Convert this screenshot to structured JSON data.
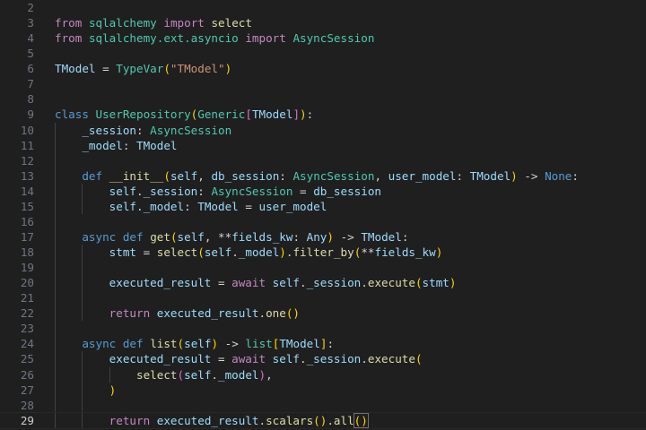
{
  "editor": {
    "current_line": 29,
    "lines": [
      {
        "n": "2",
        "indent": 0,
        "tokens": []
      },
      {
        "n": "3",
        "indent": 0,
        "tokens": [
          [
            "from",
            "kw"
          ],
          [
            " ",
            "op"
          ],
          [
            "sqlalchemy",
            "ty"
          ],
          [
            " ",
            "op"
          ],
          [
            "import",
            "kw"
          ],
          [
            " ",
            "op"
          ],
          [
            "select",
            "fn"
          ]
        ]
      },
      {
        "n": "4",
        "indent": 0,
        "tokens": [
          [
            "from",
            "kw"
          ],
          [
            " ",
            "op"
          ],
          [
            "sqlalchemy.ext.asyncio",
            "ty"
          ],
          [
            " ",
            "op"
          ],
          [
            "import",
            "kw"
          ],
          [
            " ",
            "op"
          ],
          [
            "AsyncSession",
            "ty"
          ]
        ]
      },
      {
        "n": "5",
        "indent": 0,
        "tokens": []
      },
      {
        "n": "6",
        "indent": 0,
        "tokens": [
          [
            "TModel",
            "va"
          ],
          [
            " = ",
            "op"
          ],
          [
            "TypeVar",
            "ty"
          ],
          [
            "(",
            "b1"
          ],
          [
            "\"TModel\"",
            "str"
          ],
          [
            ")",
            "b1"
          ]
        ]
      },
      {
        "n": "7",
        "indent": 0,
        "tokens": []
      },
      {
        "n": "8",
        "indent": 0,
        "tokens": []
      },
      {
        "n": "9",
        "indent": 0,
        "tokens": [
          [
            "class",
            "st"
          ],
          [
            " ",
            "op"
          ],
          [
            "UserRepository",
            "ty"
          ],
          [
            "(",
            "b1"
          ],
          [
            "Generic",
            "ty"
          ],
          [
            "[",
            "b2"
          ],
          [
            "TModel",
            "va"
          ],
          [
            "]",
            "b2"
          ],
          [
            ")",
            "b1"
          ],
          [
            ":",
            "op"
          ]
        ]
      },
      {
        "n": "10",
        "indent": 1,
        "tokens": [
          [
            "_session",
            "va"
          ],
          [
            ": ",
            "op"
          ],
          [
            "AsyncSession",
            "ty"
          ]
        ]
      },
      {
        "n": "11",
        "indent": 1,
        "tokens": [
          [
            "_model",
            "va"
          ],
          [
            ": ",
            "op"
          ],
          [
            "TModel",
            "va"
          ]
        ]
      },
      {
        "n": "12",
        "indent": 1,
        "tokens": []
      },
      {
        "n": "13",
        "indent": 1,
        "tokens": [
          [
            "def",
            "st"
          ],
          [
            " ",
            "op"
          ],
          [
            "__init__",
            "fn"
          ],
          [
            "(",
            "b1"
          ],
          [
            "self",
            "va"
          ],
          [
            ", ",
            "op"
          ],
          [
            "db_session",
            "va"
          ],
          [
            ": ",
            "op"
          ],
          [
            "AsyncSession",
            "ty"
          ],
          [
            ", ",
            "op"
          ],
          [
            "user_model",
            "va"
          ],
          [
            ": ",
            "op"
          ],
          [
            "TModel",
            "va"
          ],
          [
            ")",
            "b1"
          ],
          [
            " -> ",
            "op"
          ],
          [
            "None",
            "st"
          ],
          [
            ":",
            "op"
          ]
        ]
      },
      {
        "n": "14",
        "indent": 2,
        "tokens": [
          [
            "self",
            "va"
          ],
          [
            ".",
            "op"
          ],
          [
            "_session",
            "va"
          ],
          [
            ": ",
            "op"
          ],
          [
            "AsyncSession",
            "ty"
          ],
          [
            " = ",
            "op"
          ],
          [
            "db_session",
            "va"
          ]
        ]
      },
      {
        "n": "15",
        "indent": 2,
        "tokens": [
          [
            "self",
            "va"
          ],
          [
            ".",
            "op"
          ],
          [
            "_model",
            "va"
          ],
          [
            ": ",
            "op"
          ],
          [
            "TModel",
            "va"
          ],
          [
            " = ",
            "op"
          ],
          [
            "user_model",
            "va"
          ]
        ]
      },
      {
        "n": "16",
        "indent": 1,
        "tokens": []
      },
      {
        "n": "17",
        "indent": 1,
        "tokens": [
          [
            "async",
            "st"
          ],
          [
            " ",
            "op"
          ],
          [
            "def",
            "st"
          ],
          [
            " ",
            "op"
          ],
          [
            "get",
            "fn"
          ],
          [
            "(",
            "b1"
          ],
          [
            "self",
            "va"
          ],
          [
            ", ",
            "op"
          ],
          [
            "**",
            "op"
          ],
          [
            "fields_kw",
            "va"
          ],
          [
            ": ",
            "op"
          ],
          [
            "Any",
            "va"
          ],
          [
            ")",
            "b1"
          ],
          [
            " -> ",
            "op"
          ],
          [
            "TModel",
            "va"
          ],
          [
            ":",
            "op"
          ]
        ]
      },
      {
        "n": "18",
        "indent": 2,
        "tokens": [
          [
            "stmt",
            "va"
          ],
          [
            " = ",
            "op"
          ],
          [
            "select",
            "fn"
          ],
          [
            "(",
            "b1"
          ],
          [
            "self",
            "va"
          ],
          [
            ".",
            "op"
          ],
          [
            "_model",
            "va"
          ],
          [
            ")",
            "b1"
          ],
          [
            ".",
            "op"
          ],
          [
            "filter_by",
            "fn"
          ],
          [
            "(",
            "b1"
          ],
          [
            "**",
            "op"
          ],
          [
            "fields_kw",
            "va"
          ],
          [
            ")",
            "b1"
          ]
        ]
      },
      {
        "n": "19",
        "indent": 2,
        "tokens": []
      },
      {
        "n": "20",
        "indent": 2,
        "tokens": [
          [
            "executed_result",
            "va"
          ],
          [
            " = ",
            "op"
          ],
          [
            "await",
            "kw"
          ],
          [
            " ",
            "op"
          ],
          [
            "self",
            "va"
          ],
          [
            ".",
            "op"
          ],
          [
            "_session",
            "va"
          ],
          [
            ".",
            "op"
          ],
          [
            "execute",
            "fn"
          ],
          [
            "(",
            "b1"
          ],
          [
            "stmt",
            "va"
          ],
          [
            ")",
            "b1"
          ]
        ]
      },
      {
        "n": "21",
        "indent": 2,
        "tokens": []
      },
      {
        "n": "22",
        "indent": 2,
        "tokens": [
          [
            "return",
            "kw"
          ],
          [
            " ",
            "op"
          ],
          [
            "executed_result",
            "va"
          ],
          [
            ".",
            "op"
          ],
          [
            "one",
            "fn"
          ],
          [
            "()",
            "b1"
          ]
        ]
      },
      {
        "n": "23",
        "indent": 1,
        "tokens": []
      },
      {
        "n": "24",
        "indent": 1,
        "tokens": [
          [
            "async",
            "st"
          ],
          [
            " ",
            "op"
          ],
          [
            "def",
            "st"
          ],
          [
            " ",
            "op"
          ],
          [
            "list",
            "fn"
          ],
          [
            "(",
            "b1"
          ],
          [
            "self",
            "va"
          ],
          [
            ")",
            "b1"
          ],
          [
            " -> ",
            "op"
          ],
          [
            "list",
            "ty"
          ],
          [
            "[",
            "b1"
          ],
          [
            "TModel",
            "va"
          ],
          [
            "]",
            "b1"
          ],
          [
            ":",
            "op"
          ]
        ]
      },
      {
        "n": "25",
        "indent": 2,
        "tokens": [
          [
            "executed_result",
            "va"
          ],
          [
            " = ",
            "op"
          ],
          [
            "await",
            "kw"
          ],
          [
            " ",
            "op"
          ],
          [
            "self",
            "va"
          ],
          [
            ".",
            "op"
          ],
          [
            "_session",
            "va"
          ],
          [
            ".",
            "op"
          ],
          [
            "execute",
            "fn"
          ],
          [
            "(",
            "b1"
          ]
        ]
      },
      {
        "n": "26",
        "indent": 3,
        "tokens": [
          [
            "select",
            "fn"
          ],
          [
            "(",
            "b2"
          ],
          [
            "self",
            "va"
          ],
          [
            ".",
            "op"
          ],
          [
            "_model",
            "va"
          ],
          [
            ")",
            "b2"
          ],
          [
            ",",
            "op"
          ]
        ]
      },
      {
        "n": "27",
        "indent": 2,
        "tokens": [
          [
            ")",
            "b1"
          ]
        ]
      },
      {
        "n": "28",
        "indent": 2,
        "tokens": []
      },
      {
        "n": "29",
        "indent": 2,
        "tokens": [
          [
            "return",
            "kw"
          ],
          [
            " ",
            "op"
          ],
          [
            "executed_result",
            "va"
          ],
          [
            ".",
            "op"
          ],
          [
            "scalars",
            "fn"
          ],
          [
            "()",
            "b1"
          ],
          [
            ".",
            "op"
          ],
          [
            "all",
            "fn"
          ],
          [
            "()",
            "b1 match"
          ]
        ]
      }
    ]
  }
}
